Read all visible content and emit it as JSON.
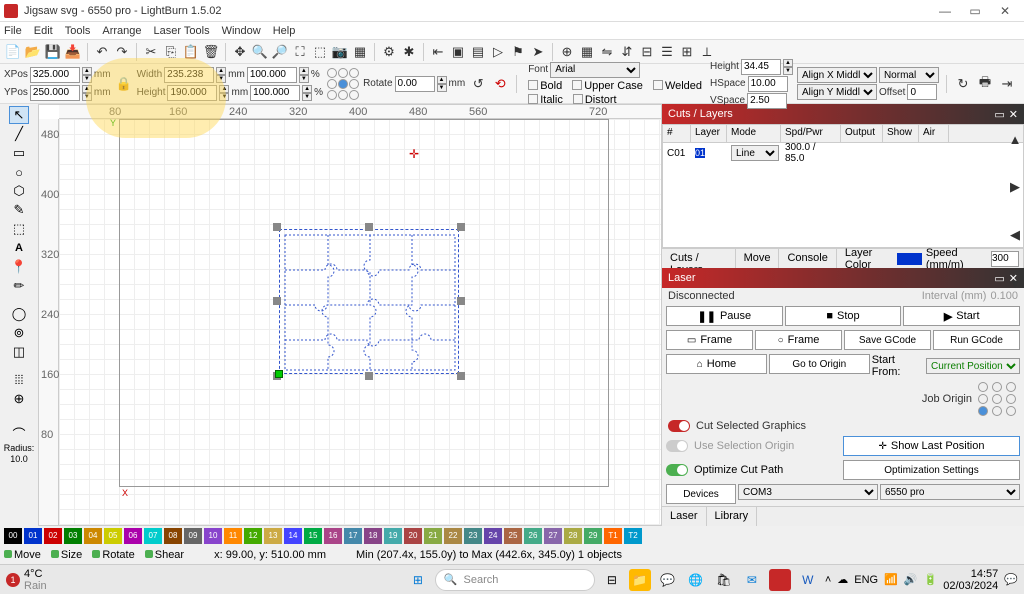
{
  "title": "Jigsaw svg - 6550 pro - LightBurn 1.5.02",
  "menus": [
    "File",
    "Edit",
    "Tools",
    "Arrange",
    "Laser Tools",
    "Window",
    "Help"
  ],
  "xpos": "325.000",
  "ypos": "250.000",
  "width": "235.238",
  "height": "190.000",
  "wpct": "100.000",
  "hpct": "100.000",
  "rotate": "0.00",
  "font_label": "Font",
  "font_value": "Arial",
  "bold": "Bold",
  "italic": "Italic",
  "upper": "Upper Case",
  "distort": "Distort",
  "welded": "Welded",
  "height_label": "Height",
  "height_value": "34.45",
  "hspace_label": "HSpace",
  "hspace_value": "10.00",
  "vspace_label": "VSpace",
  "vspace_value": "2.50",
  "alignx": "Align X  Middle",
  "aligny": "Align Y  Middle",
  "normal": "Normal",
  "offset_label": "Offset",
  "offset_value": "0",
  "cuts_layers": "Cuts / Layers",
  "col_hash": "#",
  "col_layer": "Layer",
  "col_mode": "Mode",
  "col_spd": "Spd/Pwr",
  "col_output": "Output",
  "col_show": "Show",
  "col_air": "Air",
  "layer_c": "C01",
  "layer_n": "01",
  "layer_mode": "Line",
  "layer_spd": "300.0 / 85.0",
  "tab_cuts": "Cuts / Layers",
  "tab_move": "Move",
  "tab_console": "Console",
  "layer_color_label": "Layer Color",
  "speed_label": "Speed (mm/m)",
  "speed_val": "300",
  "laser_panel": "Laser",
  "disconnected": "Disconnected",
  "pause": "Pause",
  "stop": "Stop",
  "start": "Start",
  "frame": "Frame",
  "save_gcode": "Save GCode",
  "run_gcode": "Run GCode",
  "home": "Home",
  "goto_origin": "Go to Origin",
  "start_from": "Start From:",
  "start_from_val": "Current Position",
  "job_origin": "Job Origin",
  "cut_sel": "Cut Selected Graphics",
  "use_sel": "Use Selection Origin",
  "show_last": "Show Last Position",
  "opt_cut": "Optimize Cut Path",
  "opt_settings": "Optimization Settings",
  "devices": "Devices",
  "com": "COM3",
  "device_name": "6550 pro",
  "tab_laser": "Laser",
  "tab_library": "Library",
  "move_lbl": "Move",
  "size_lbl": "Size",
  "rotate_lbl": "Rotate",
  "shear_lbl": "Shear",
  "status_pos": "x: 99.00, y: 510.00 mm",
  "status_sel": "Min (207.4x, 155.0y) to Max (442.6x, 345.0y)  1 objects",
  "radius_label": "Radius:",
  "radius_val": "10.0",
  "interval_lbl": "Interval (mm)",
  "interval_val": "0.100",
  "ruler_h": [
    "80",
    "160",
    "240",
    "320",
    "400",
    "480",
    "560",
    "720",
    "720"
  ],
  "ruler_v": [
    "480",
    "400",
    "320",
    "240",
    "160",
    "80"
  ],
  "weather_temp": "4°C",
  "weather_cond": "Rain",
  "search_placeholder": "Search",
  "time": "14:57",
  "date": "02/03/2024",
  "colorbar": [
    {
      "n": "00",
      "c": "#000"
    },
    {
      "n": "01",
      "c": "#0033cc"
    },
    {
      "n": "02",
      "c": "#cc0000"
    },
    {
      "n": "03",
      "c": "#007f00"
    },
    {
      "n": "04",
      "c": "#cc8800"
    },
    {
      "n": "05",
      "c": "#cccc00"
    },
    {
      "n": "06",
      "c": "#aa00aa"
    },
    {
      "n": "07",
      "c": "#00cccc"
    },
    {
      "n": "08",
      "c": "#884400"
    },
    {
      "n": "09",
      "c": "#666"
    },
    {
      "n": "10",
      "c": "#8844cc"
    },
    {
      "n": "11",
      "c": "#ff8800"
    },
    {
      "n": "12",
      "c": "#44aa00"
    },
    {
      "n": "13",
      "c": "#ccaa44"
    },
    {
      "n": "14",
      "c": "#4444ff"
    },
    {
      "n": "15",
      "c": "#00aa44"
    },
    {
      "n": "16",
      "c": "#aa4488"
    },
    {
      "n": "17",
      "c": "#4488aa"
    },
    {
      "n": "18",
      "c": "#884488"
    },
    {
      "n": "19",
      "c": "#44aaaa"
    },
    {
      "n": "20",
      "c": "#aa4444"
    },
    {
      "n": "21",
      "c": "#88aa44"
    },
    {
      "n": "22",
      "c": "#aa8844"
    },
    {
      "n": "23",
      "c": "#448888"
    },
    {
      "n": "24",
      "c": "#6644aa"
    },
    {
      "n": "25",
      "c": "#aa6644"
    },
    {
      "n": "26",
      "c": "#44aa88"
    },
    {
      "n": "27",
      "c": "#8866aa"
    },
    {
      "n": "28",
      "c": "#aaaa44"
    },
    {
      "n": "29",
      "c": "#44aa66"
    },
    {
      "n": "T1",
      "c": "#ff6600"
    },
    {
      "n": "T2",
      "c": "#0099cc"
    }
  ]
}
